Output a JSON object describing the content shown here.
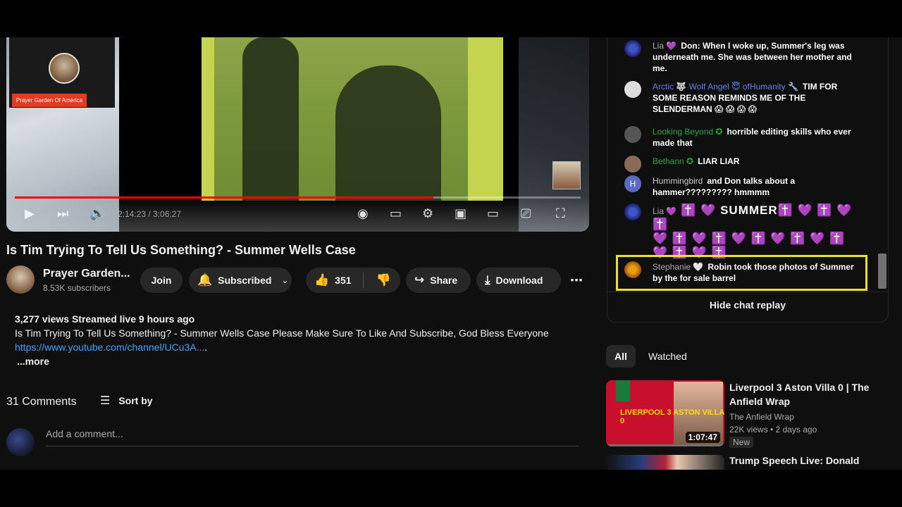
{
  "player": {
    "channel_tag": "Prayer Garden Of America",
    "time_display": "2:14:23 / 3:06:27",
    "progress_fraction": 0.74
  },
  "video": {
    "title": "Is Tim Trying To Tell Us Something? - Summer Wells Case",
    "channel_name": "Prayer Garden...",
    "subscribers": "8.53K subscribers",
    "join_label": "Join",
    "subscribed_label": "Subscribed",
    "like_count": "351",
    "share_label": "Share",
    "download_label": "Download"
  },
  "description": {
    "stats": "3,277 views  Streamed live 9 hours ago",
    "text": "Is Tim Trying To Tell Us Something? - Summer Wells Case Please Make Sure To Like And Subscribe, God Bless Everyone",
    "link": "https://www.youtube.com/channel/UCu3A...",
    "link_suffix": ".",
    "more": "...more"
  },
  "comments": {
    "count": "31 Comments",
    "sort_label": "Sort by",
    "add_placeholder": "Add a comment..."
  },
  "chat": {
    "messages": [
      {
        "author": "Lia 💜",
        "text": "Don: When I woke up, Summer's leg was underneath me. She was between her mother and me."
      },
      {
        "author": "Arctic 🐺 Wolf Angel 😇 ofHumanity 🔧",
        "text": "TIM FOR SOME REASON REMINDS ME OF THE SLENDERMAN 😱 😱 😱 😱"
      },
      {
        "author": "Looking Beyond ✪",
        "text": "horrible editing skills who ever made that"
      },
      {
        "author": "Bethann ✪",
        "text": "LIAR LIAR"
      },
      {
        "author": "Hummingbird",
        "avatar_letter": "H",
        "text": "and Don talks about a hammer????????? hmmmm"
      },
      {
        "author": "Lia 💜",
        "text_prefix": "✝️ 💜 SUMMER",
        "emoji_line1": "✝️ 💜 ✝️ 💜 ✝️",
        "emoji_line2": "💜 ✝️ 💜 ✝️ 💜 ✝️ 💜 ✝️ 💜 ✝️",
        "emoji_line3": "💜 ✝️ 💜 ✝️"
      },
      {
        "author": "Stephanie 🤍",
        "text": "Robin took those photos of Summer by the for sale barrel"
      }
    ],
    "hide_label": "Hide chat replay"
  },
  "related": {
    "chips": [
      "All",
      "Watched"
    ],
    "items": [
      {
        "title": "Liverpool 3 Aston Villa 0 | The Anfield Wrap",
        "channel": "The Anfield Wrap",
        "meta": "22K views • 2 days ago",
        "badge": "New",
        "duration": "1:07:47",
        "thumb_text": "LIVERPOOL 3 ASTON VILLA 0"
      },
      {
        "title": "Trump Speech Live: Donald"
      }
    ]
  },
  "colors": {
    "background": "#0f0f0f",
    "progress_red": "#ff0000",
    "link_blue": "#3ea6ff",
    "highlight_yellow": "#e8e22a"
  }
}
